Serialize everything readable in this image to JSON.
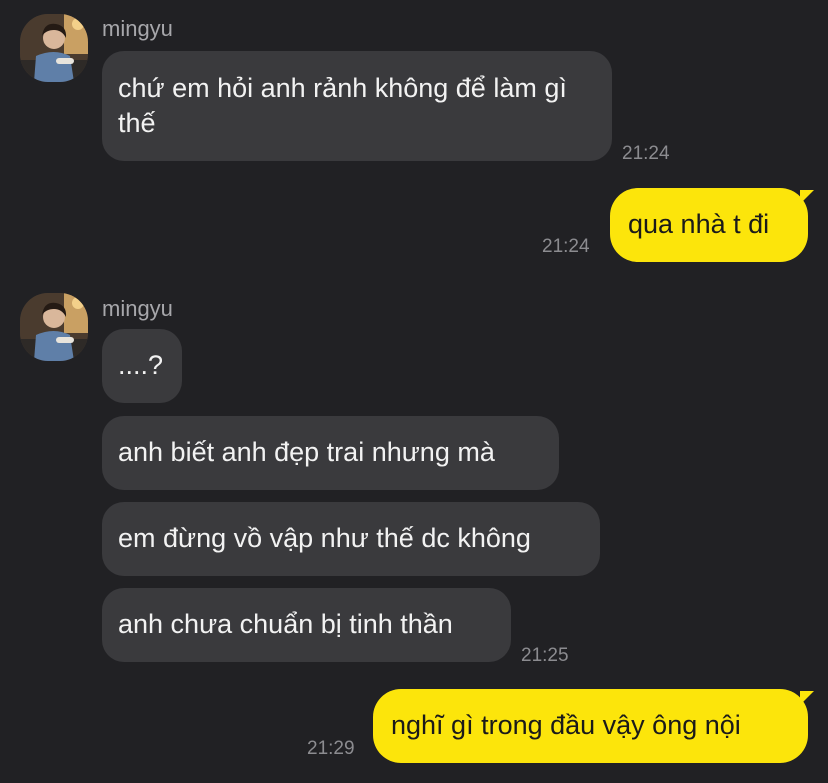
{
  "chat": {
    "contact_name": "mingyu",
    "colors": {
      "background": "#212124",
      "incoming_bubble": "#3a3a3d",
      "outgoing_bubble": "#fce50b",
      "timestamp": "#8c8c90"
    },
    "messages": [
      {
        "direction": "incoming",
        "sender": "mingyu",
        "text": "chứ em hỏi anh rảnh không để làm gì thế",
        "time": "21:24"
      },
      {
        "direction": "outgoing",
        "text": "qua nhà t đi",
        "time": "21:24"
      },
      {
        "direction": "incoming",
        "sender": "mingyu",
        "text": "....?"
      },
      {
        "direction": "incoming",
        "text": "anh biết anh đẹp trai nhưng mà"
      },
      {
        "direction": "incoming",
        "text": "em đừng vồ vập như thế dc không"
      },
      {
        "direction": "incoming",
        "text": "anh chưa chuẩn bị tinh thần",
        "time": "21:25"
      },
      {
        "direction": "outgoing",
        "text": "nghĩ gì trong đầu vậy ông nội",
        "time": "21:29"
      }
    ]
  }
}
